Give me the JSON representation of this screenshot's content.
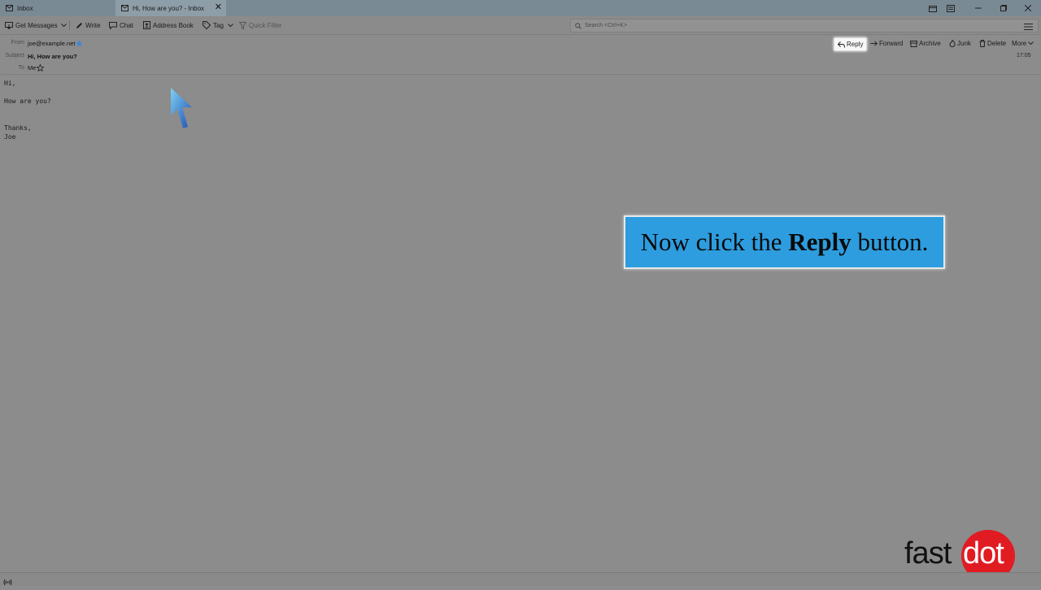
{
  "tabs": [
    {
      "label": "Inbox"
    },
    {
      "label": "Hi, How are you? - Inbox"
    }
  ],
  "toolbar": {
    "get_messages": "Get Messages",
    "write": "Write",
    "chat": "Chat",
    "address_book": "Address Book",
    "tag": "Tag",
    "quick_filter": "Quick Filter"
  },
  "search": {
    "placeholder": "Search <Ctrl+K>"
  },
  "header": {
    "from_label": "From",
    "from_value": "joe@example.net",
    "subject_label": "Subject",
    "subject_value": "Hi, How are you?",
    "to_label": "To",
    "to_value": "Me",
    "time": "17:05"
  },
  "actions": {
    "reply": "Reply",
    "forward": "Forward",
    "archive": "Archive",
    "junk": "Junk",
    "delete": "Delete",
    "more": "More"
  },
  "body_lines": [
    "Hi,",
    "",
    "How are you?",
    "",
    "",
    "Thanks,",
    "Joe"
  ],
  "callout": {
    "prefix": "Now click the ",
    "bold": "Reply",
    "suffix": " button."
  },
  "logo": {
    "part1": "fast",
    "part2": "dot"
  },
  "colors": {
    "callout_bg": "#2d9ddf",
    "logo_red": "#e11b22",
    "star_blue": "#3a86d8"
  }
}
